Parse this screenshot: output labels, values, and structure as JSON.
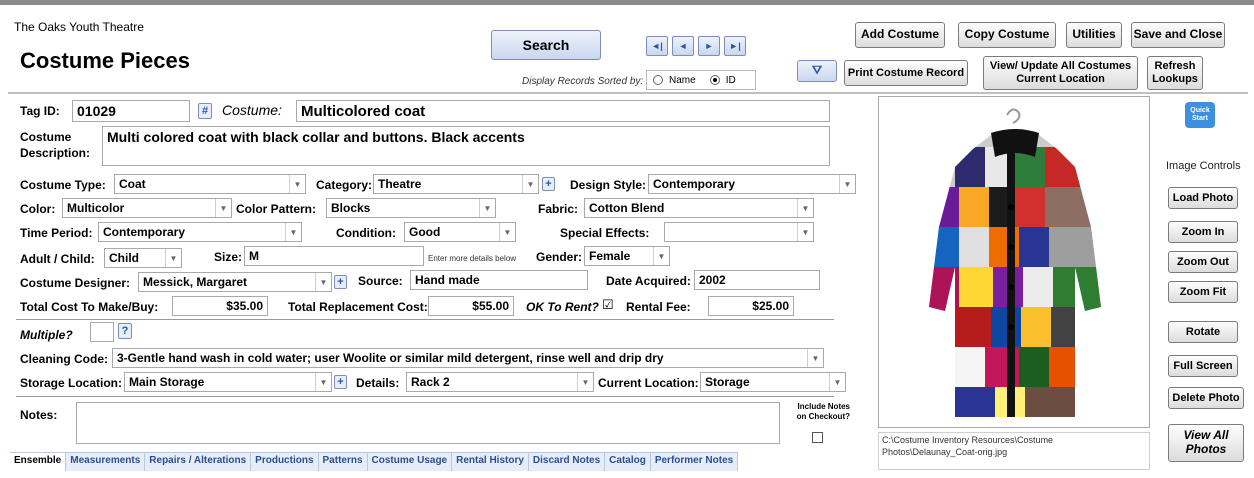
{
  "app": {
    "title": "The Oaks Youth Theatre",
    "page_title": "Costume Pieces"
  },
  "toolbar": {
    "search": "Search",
    "nav_first": "◄|",
    "nav_prev": "◄",
    "nav_next": "►",
    "nav_last": "|►",
    "sorted_label": "Display Records Sorted by:",
    "sort_name": "Name",
    "sort_id": "ID",
    "sort_selected": "ID",
    "add_costume": "Add Costume",
    "copy_costume": "Copy Costume",
    "utilities": "Utilities",
    "save_close": "Save and Close",
    "filter_icon": "funnel-icon",
    "print_record": "Print Costume Record",
    "update_all_l1": "View/ Update All Costumes",
    "update_all_l2": "Current Location",
    "refresh_l1": "Refresh",
    "refresh_l2": "Lookups"
  },
  "form": {
    "tag_id_label": "Tag ID:",
    "tag_id": "01029",
    "hash_btn": "#",
    "costume_label": "Costume:",
    "costume": "Multicolored coat",
    "desc_label_l1": "Costume",
    "desc_label_l2": "Description:",
    "description": "Multi colored coat with black collar and buttons.  Black accents",
    "type_label": "Costume Type:",
    "type": "Coat",
    "category_label": "Category:",
    "category": "Theatre",
    "design_label": "Design Style:",
    "design": "Contemporary",
    "color_label": "Color:",
    "color": "Multicolor",
    "pattern_label": "Color Pattern:",
    "pattern": "Blocks",
    "fabric_label": "Fabric:",
    "fabric": "Cotton Blend",
    "period_label": "Time Period:",
    "period": "Contemporary",
    "condition_label": "Condition:",
    "condition": "Good",
    "effects_label": "Special Effects:",
    "effects": "",
    "adult_label": "Adult / Child:",
    "adult": "Child",
    "size_label": "Size:",
    "size": "M",
    "more_details": "Enter more details below",
    "gender_label": "Gender:",
    "gender": "Female",
    "designer_label": "Costume Designer:",
    "designer": "Messick, Margaret",
    "source_label": "Source:",
    "source": "Hand made",
    "acquired_label": "Date Acquired:",
    "acquired": "2002",
    "total_cost_label": "Total Cost To Make/Buy:",
    "total_cost": "$35.00",
    "replacement_label": "Total Replacement Cost:",
    "replacement": "$55.00",
    "ok_rent_label": "OK To Rent?",
    "ok_rent_checked": "☑",
    "rental_fee_label": "Rental Fee:",
    "rental_fee": "$25.00",
    "multiple_label": "Multiple?",
    "help_btn": "?",
    "cleaning_label": "Cleaning Code:",
    "cleaning": "3-Gentle hand wash in cold water; user Woolite or similar mild detergent, rinse well and drip dry",
    "storage_label": "Storage Location:",
    "storage": "Main Storage",
    "details_label": "Details:",
    "details": "Rack 2",
    "current_label": "Current Location:",
    "current": "Storage",
    "notes_label": "Notes:",
    "notes": "",
    "include_notes_l1": "Include Notes",
    "include_notes_l2": "on Checkout?"
  },
  "tabs": [
    "Ensemble",
    "Measurements",
    "Repairs / Alterations",
    "Productions",
    "Patterns",
    "Costume Usage",
    "Rental History",
    "Discard Notes",
    "Catalog",
    "Performer Notes"
  ],
  "image": {
    "path_l1": "C:\\Costume Inventory Resources\\Costume",
    "path_l2": "Photos\\Delaunay_Coat-orig.jpg"
  },
  "side": {
    "quick_l1": "Quick",
    "quick_l2": "Start",
    "image_controls": "Image Controls",
    "load_photo": "Load Photo",
    "zoom_in": "Zoom In",
    "zoom_out": "Zoom Out",
    "zoom_fit": "Zoom Fit",
    "rotate": "Rotate",
    "full_screen": "Full Screen",
    "delete_photo": "Delete Photo",
    "view_all_l1": "View All",
    "view_all_l2": "Photos"
  }
}
